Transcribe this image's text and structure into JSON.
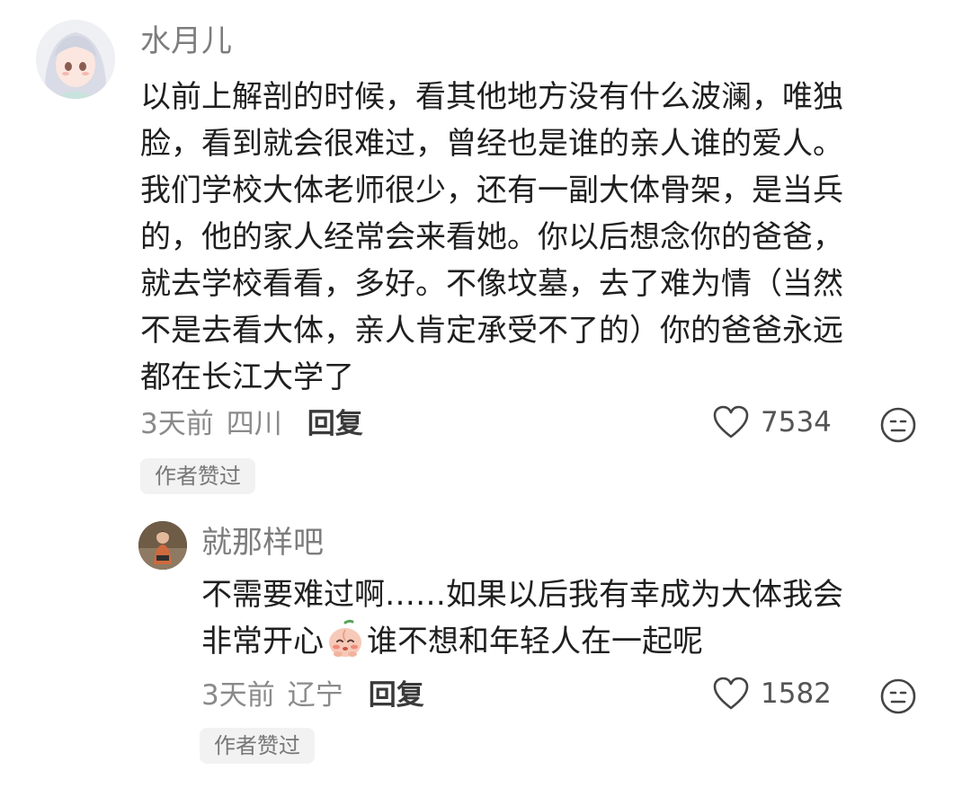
{
  "comments": [
    {
      "username": "水月儿",
      "text_lines": [
        "以前上解剖的时候，看其他地方没有什么波澜，唯独",
        "脸，看到就会很难过，曾经也是谁的亲人谁的爱人。",
        "我们学校大体老师很少，还有一副大体骨架，是当兵",
        "的，他的家人经常会来看她。你以后想念你的爸爸，",
        "就去学校看看，多好。不像坟墓，去了难为情（当然",
        "不是去看大体，亲人肯定承受不了的）你的爸爸永远",
        "都在长江大学了"
      ],
      "time": "3天前",
      "location": "四川",
      "reply_label": "回复",
      "likes": "7534",
      "badge": "作者赞过",
      "avatar_icon": "anime-girl-avatar",
      "like_icon": "heart-outline-icon",
      "react_icon": "face-emoji-icon"
    },
    {
      "username": "就那样吧",
      "text_line1": "不需要难过啊……如果以后我有幸成为大体我会",
      "text_line2_before": "非常开心",
      "text_line2_after": "谁不想和年轻人在一起呢",
      "inline_emoji": "shy-peach-emoji",
      "time": "3天前",
      "location": "辽宁",
      "reply_label": "回复",
      "likes": "1582",
      "badge": "作者赞过",
      "avatar_icon": "person-photo-avatar",
      "like_icon": "heart-outline-icon",
      "react_icon": "face-emoji-icon"
    }
  ]
}
